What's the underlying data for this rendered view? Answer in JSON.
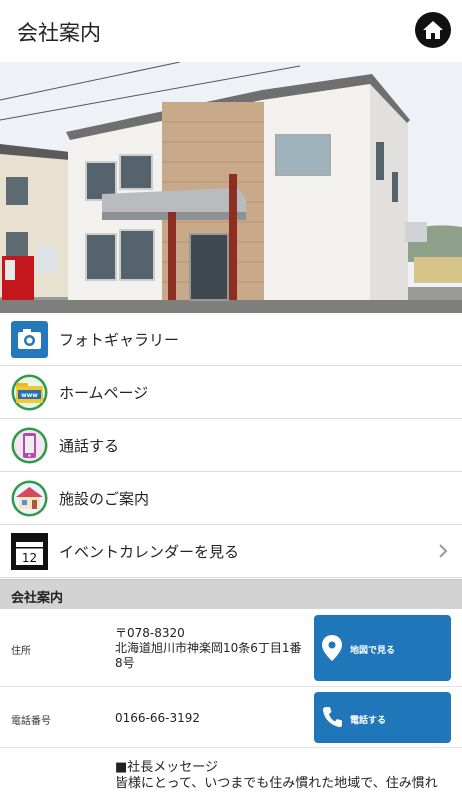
{
  "header": {
    "title": "会社案内",
    "home_icon": "home-icon"
  },
  "menu": [
    {
      "label": "フォトギャラリー",
      "icon": "camera-icon"
    },
    {
      "label": "ホームページ",
      "icon": "www-folder-icon"
    },
    {
      "label": "通話する",
      "icon": "phone-icon"
    },
    {
      "label": "施設のご案内",
      "icon": "house-icon"
    },
    {
      "label": "イベントカレンダーを見る",
      "icon": "calendar-icon",
      "calendar_day": "12"
    }
  ],
  "section": {
    "title": "会社案内"
  },
  "address": {
    "label": "住所",
    "postal": "〒078-8320",
    "line1": "北海道旭川市神楽岡10条6丁目1番",
    "line2": "8号",
    "button_label": "地図で見る",
    "button_icon": "map-pin-icon"
  },
  "phone": {
    "label": "電話番号",
    "number": "0166-66-3192",
    "button_label": "電話する",
    "button_icon": "phone-handset-icon"
  },
  "message": {
    "heading": "■社長メッセージ",
    "line1": "皆様にとって、いつまでも住み慣れた地域で、住み慣れ"
  },
  "colors": {
    "button_blue": "#1f76b8",
    "section_bg": "#d3d3d3",
    "camera_blue": "#2479bd"
  }
}
